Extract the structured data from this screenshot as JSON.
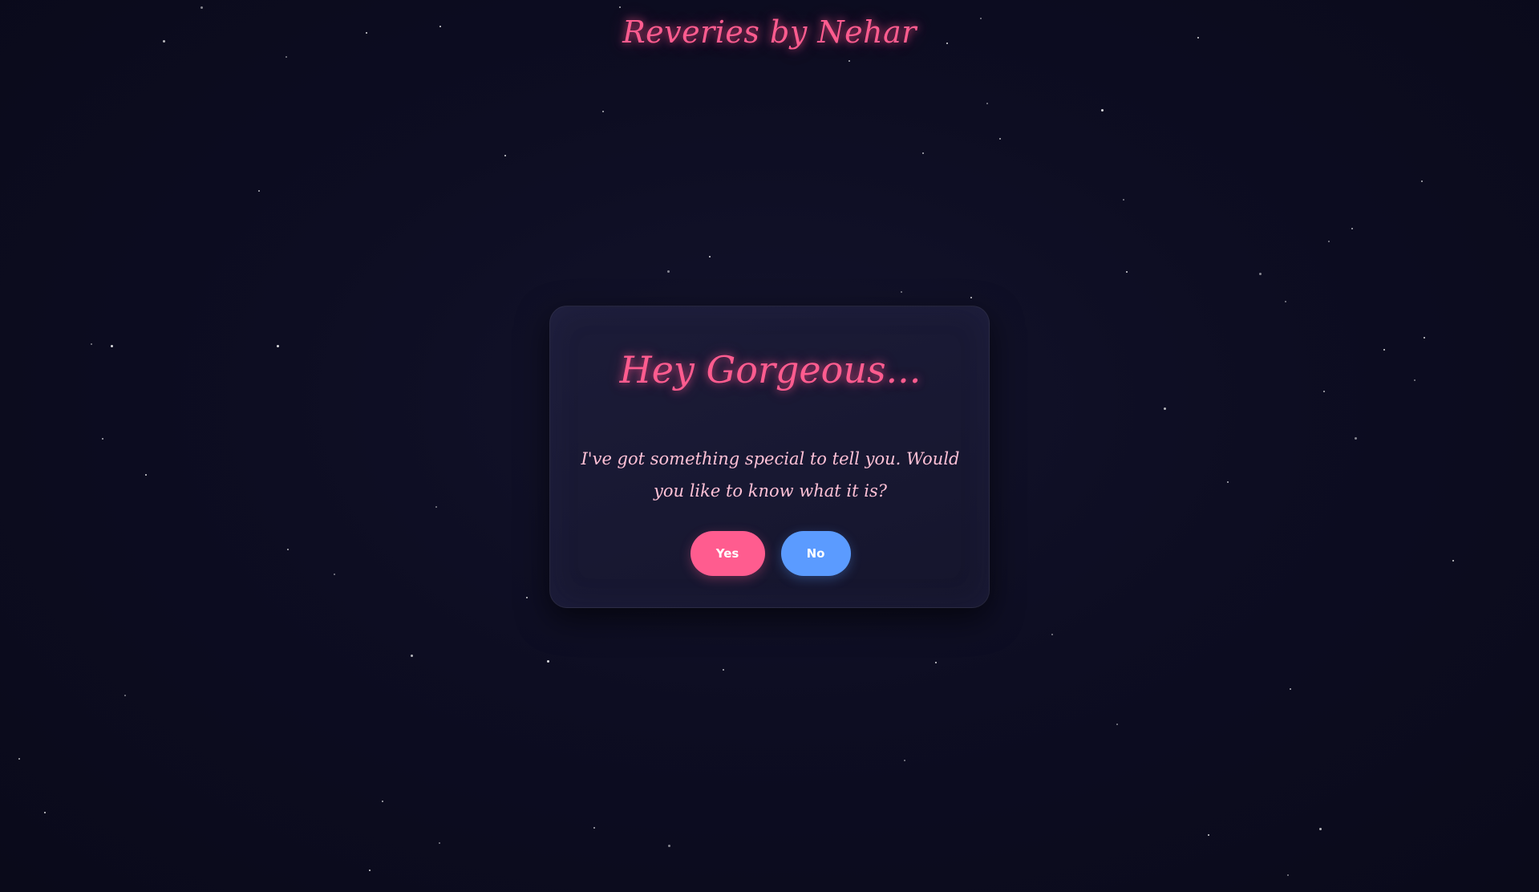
{
  "header": {
    "brand": "Reveries by Nehar"
  },
  "dialog": {
    "title": "Hey Gorgeous...",
    "message": "I've got something special to tell you. Would you like to know what it is?",
    "yes_label": "Yes",
    "no_label": "No"
  },
  "colors": {
    "background": "#0b0b1d",
    "accent_pink": "#ff5c8f",
    "message_pink": "#ffc1d6",
    "button_blue": "#5b9bff"
  }
}
